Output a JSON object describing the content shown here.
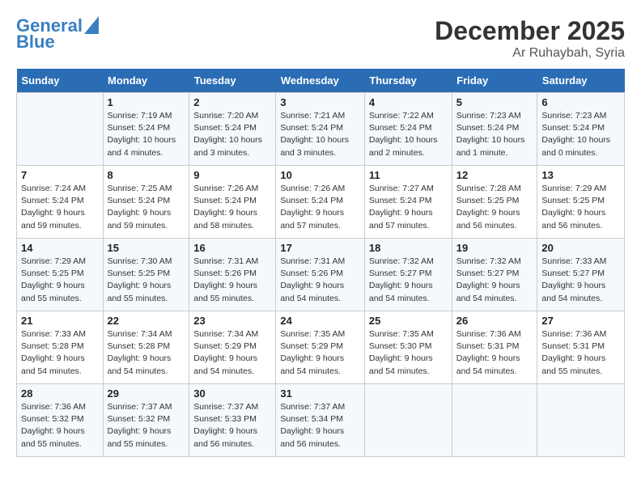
{
  "header": {
    "logo_line1": "General",
    "logo_line2": "Blue",
    "month": "December 2025",
    "location": "Ar Ruhaybah, Syria"
  },
  "days_of_week": [
    "Sunday",
    "Monday",
    "Tuesday",
    "Wednesday",
    "Thursday",
    "Friday",
    "Saturday"
  ],
  "weeks": [
    [
      {
        "day": "",
        "info": ""
      },
      {
        "day": "1",
        "info": "Sunrise: 7:19 AM\nSunset: 5:24 PM\nDaylight: 10 hours\nand 4 minutes."
      },
      {
        "day": "2",
        "info": "Sunrise: 7:20 AM\nSunset: 5:24 PM\nDaylight: 10 hours\nand 3 minutes."
      },
      {
        "day": "3",
        "info": "Sunrise: 7:21 AM\nSunset: 5:24 PM\nDaylight: 10 hours\nand 3 minutes."
      },
      {
        "day": "4",
        "info": "Sunrise: 7:22 AM\nSunset: 5:24 PM\nDaylight: 10 hours\nand 2 minutes."
      },
      {
        "day": "5",
        "info": "Sunrise: 7:23 AM\nSunset: 5:24 PM\nDaylight: 10 hours\nand 1 minute."
      },
      {
        "day": "6",
        "info": "Sunrise: 7:23 AM\nSunset: 5:24 PM\nDaylight: 10 hours\nand 0 minutes."
      }
    ],
    [
      {
        "day": "7",
        "info": "Sunrise: 7:24 AM\nSunset: 5:24 PM\nDaylight: 9 hours\nand 59 minutes."
      },
      {
        "day": "8",
        "info": "Sunrise: 7:25 AM\nSunset: 5:24 PM\nDaylight: 9 hours\nand 59 minutes."
      },
      {
        "day": "9",
        "info": "Sunrise: 7:26 AM\nSunset: 5:24 PM\nDaylight: 9 hours\nand 58 minutes."
      },
      {
        "day": "10",
        "info": "Sunrise: 7:26 AM\nSunset: 5:24 PM\nDaylight: 9 hours\nand 57 minutes."
      },
      {
        "day": "11",
        "info": "Sunrise: 7:27 AM\nSunset: 5:24 PM\nDaylight: 9 hours\nand 57 minutes."
      },
      {
        "day": "12",
        "info": "Sunrise: 7:28 AM\nSunset: 5:25 PM\nDaylight: 9 hours\nand 56 minutes."
      },
      {
        "day": "13",
        "info": "Sunrise: 7:29 AM\nSunset: 5:25 PM\nDaylight: 9 hours\nand 56 minutes."
      }
    ],
    [
      {
        "day": "14",
        "info": "Sunrise: 7:29 AM\nSunset: 5:25 PM\nDaylight: 9 hours\nand 55 minutes."
      },
      {
        "day": "15",
        "info": "Sunrise: 7:30 AM\nSunset: 5:25 PM\nDaylight: 9 hours\nand 55 minutes."
      },
      {
        "day": "16",
        "info": "Sunrise: 7:31 AM\nSunset: 5:26 PM\nDaylight: 9 hours\nand 55 minutes."
      },
      {
        "day": "17",
        "info": "Sunrise: 7:31 AM\nSunset: 5:26 PM\nDaylight: 9 hours\nand 54 minutes."
      },
      {
        "day": "18",
        "info": "Sunrise: 7:32 AM\nSunset: 5:27 PM\nDaylight: 9 hours\nand 54 minutes."
      },
      {
        "day": "19",
        "info": "Sunrise: 7:32 AM\nSunset: 5:27 PM\nDaylight: 9 hours\nand 54 minutes."
      },
      {
        "day": "20",
        "info": "Sunrise: 7:33 AM\nSunset: 5:27 PM\nDaylight: 9 hours\nand 54 minutes."
      }
    ],
    [
      {
        "day": "21",
        "info": "Sunrise: 7:33 AM\nSunset: 5:28 PM\nDaylight: 9 hours\nand 54 minutes."
      },
      {
        "day": "22",
        "info": "Sunrise: 7:34 AM\nSunset: 5:28 PM\nDaylight: 9 hours\nand 54 minutes."
      },
      {
        "day": "23",
        "info": "Sunrise: 7:34 AM\nSunset: 5:29 PM\nDaylight: 9 hours\nand 54 minutes."
      },
      {
        "day": "24",
        "info": "Sunrise: 7:35 AM\nSunset: 5:29 PM\nDaylight: 9 hours\nand 54 minutes."
      },
      {
        "day": "25",
        "info": "Sunrise: 7:35 AM\nSunset: 5:30 PM\nDaylight: 9 hours\nand 54 minutes."
      },
      {
        "day": "26",
        "info": "Sunrise: 7:36 AM\nSunset: 5:31 PM\nDaylight: 9 hours\nand 54 minutes."
      },
      {
        "day": "27",
        "info": "Sunrise: 7:36 AM\nSunset: 5:31 PM\nDaylight: 9 hours\nand 55 minutes."
      }
    ],
    [
      {
        "day": "28",
        "info": "Sunrise: 7:36 AM\nSunset: 5:32 PM\nDaylight: 9 hours\nand 55 minutes."
      },
      {
        "day": "29",
        "info": "Sunrise: 7:37 AM\nSunset: 5:32 PM\nDaylight: 9 hours\nand 55 minutes."
      },
      {
        "day": "30",
        "info": "Sunrise: 7:37 AM\nSunset: 5:33 PM\nDaylight: 9 hours\nand 56 minutes."
      },
      {
        "day": "31",
        "info": "Sunrise: 7:37 AM\nSunset: 5:34 PM\nDaylight: 9 hours\nand 56 minutes."
      },
      {
        "day": "",
        "info": ""
      },
      {
        "day": "",
        "info": ""
      },
      {
        "day": "",
        "info": ""
      }
    ]
  ]
}
